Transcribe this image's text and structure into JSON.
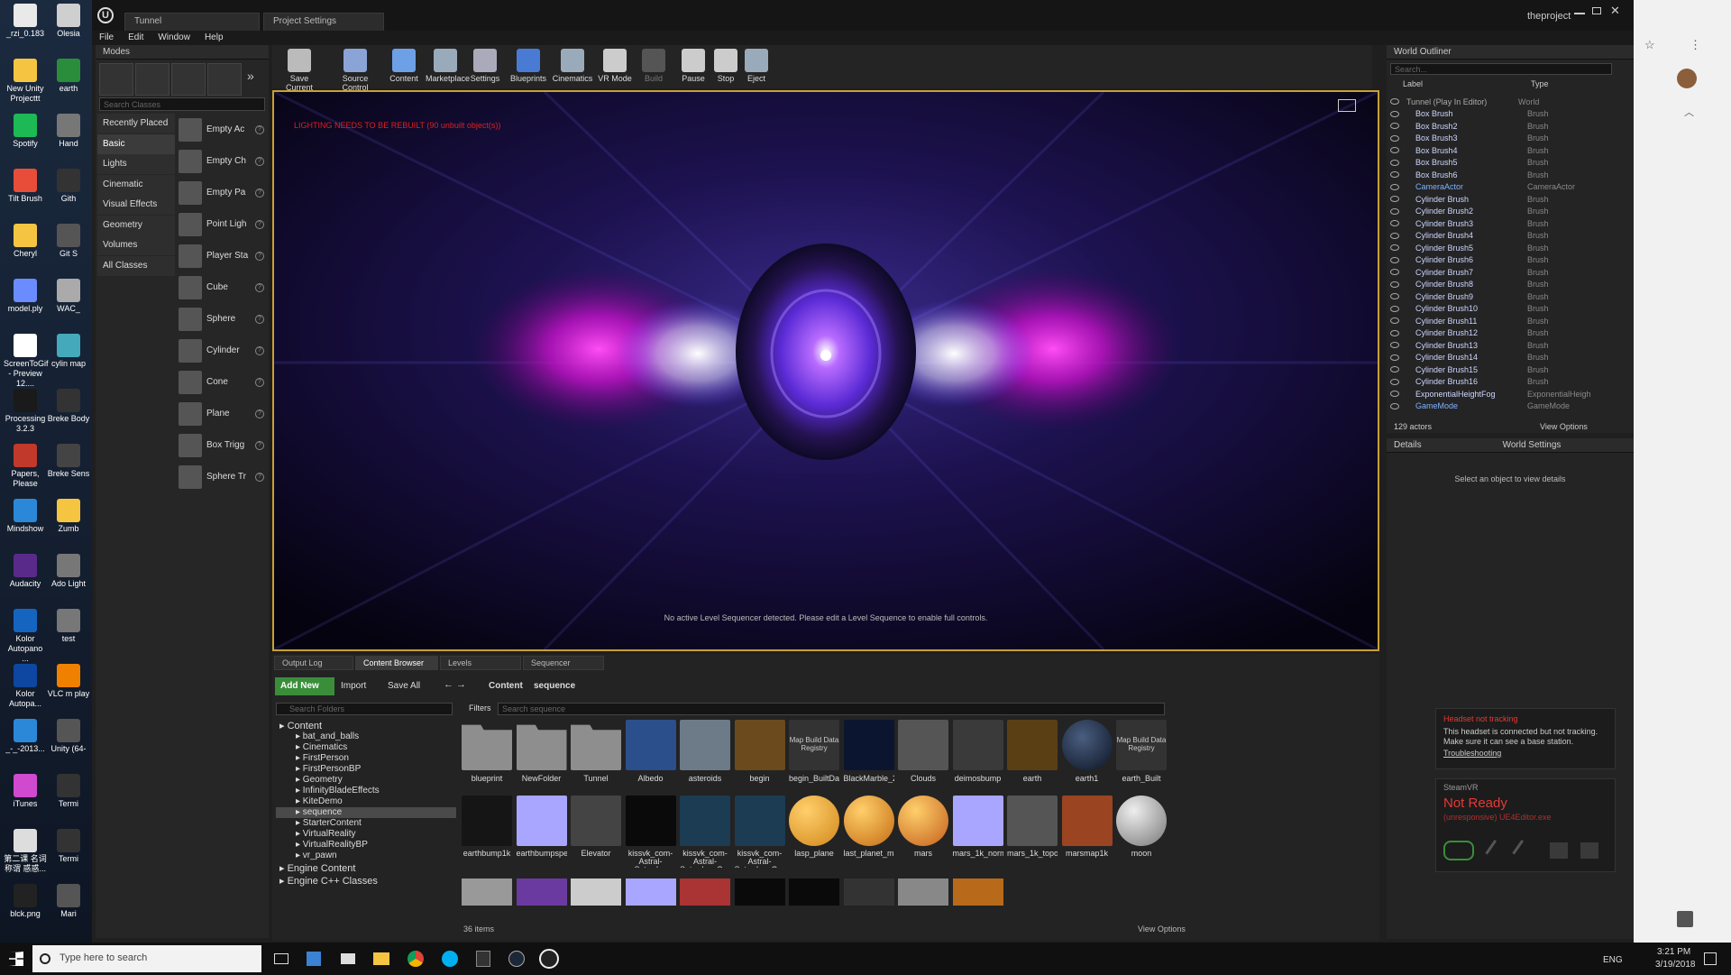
{
  "desktop_icons": [
    {
      "label": "_rzi_0.183"
    },
    {
      "label": "Olesia"
    },
    {
      "label": "New Unity Projecttt"
    },
    {
      "label": "earth"
    },
    {
      "label": "Spotify"
    },
    {
      "label": "Hand"
    },
    {
      "label": "Tilt Brush"
    },
    {
      "label": "Gith"
    },
    {
      "label": "Cheryl"
    },
    {
      "label": "Git S"
    },
    {
      "label": "model.ply"
    },
    {
      "label": "WAC_"
    },
    {
      "label": "ScreenToGif - Preview 12...."
    },
    {
      "label": "cylin map"
    },
    {
      "label": "Processing 3.2.3"
    },
    {
      "label": "Breke Body"
    },
    {
      "label": "Papers, Please"
    },
    {
      "label": "Breke Sens"
    },
    {
      "label": "Mindshow"
    },
    {
      "label": "Zumb"
    },
    {
      "label": "Audacity"
    },
    {
      "label": "Ado Light"
    },
    {
      "label": "Kolor Autopano ..."
    },
    {
      "label": "test"
    },
    {
      "label": "Kolor Autopa..."
    },
    {
      "label": "VLC m play"
    },
    {
      "label": "_-_-2013..."
    },
    {
      "label": "Unity (64-"
    },
    {
      "label": "iTunes"
    },
    {
      "label": "Termi"
    },
    {
      "label": "第二课 名词 称谓 惑惑..."
    },
    {
      "label": "Termi"
    },
    {
      "label": "blck.png"
    },
    {
      "label": "Mari"
    }
  ],
  "editor": {
    "tabs": [
      "Tunnel",
      "Project Settings"
    ],
    "project_name": "theproject",
    "menu": [
      "File",
      "Edit",
      "Window",
      "Help"
    ]
  },
  "modes": {
    "header": "Modes",
    "search_placeholder": "Search Classes",
    "categories": [
      "Recently Placed",
      "Basic",
      "Lights",
      "Cinematic",
      "Visual Effects",
      "Geometry",
      "Volumes",
      "All Classes"
    ],
    "items": [
      "Empty Ac",
      "Empty Ch",
      "Empty Pa",
      "Point Ligh",
      "Player Sta",
      "Cube",
      "Sphere",
      "Cylinder",
      "Cone",
      "Plane",
      "Box Trigg",
      "Sphere Tr"
    ]
  },
  "toolbar": [
    "Save Current",
    "Source Control",
    "Content",
    "Marketplace",
    "Settings",
    "Blueprints",
    "Cinematics",
    "VR Mode",
    "Build",
    "Pause",
    "Stop",
    "Eject"
  ],
  "viewport": {
    "warning": "LIGHTING NEEDS TO BE REBUILT (90 unbuilt object(s))",
    "status": "No active Level Sequencer detected. Please edit a Level Sequence to enable full controls."
  },
  "bottom": {
    "tabs": [
      "Output Log",
      "Content Browser",
      "Levels",
      "Sequencer"
    ],
    "add_new": "Add New",
    "import": "Import",
    "save_all": "Save All",
    "path": [
      "Content",
      "sequence"
    ],
    "search_folders": "Search Folders",
    "filters": "Filters",
    "search_assets": "Search sequence",
    "tree": [
      "Content",
      "bat_and_balls",
      "Cinematics",
      "FirstPerson",
      "FirstPersonBP",
      "Geometry",
      "InfinityBladeEffects",
      "KiteDemo",
      "sequence",
      "StarterContent",
      "VirtualReality",
      "VirtualRealityBP",
      "vr_pawn",
      "Engine Content",
      "Engine C++ Classes"
    ],
    "assets_row1": [
      "blueprint",
      "NewFolder",
      "Tunnel",
      "Albedo",
      "asteroids",
      "begin",
      "begin_BuiltData",
      "BlackMarble_2016_3km",
      "Clouds",
      "deimosbump",
      "earth",
      "earth1",
      "earth_Built"
    ],
    "assets_row2": [
      "earthbump1k",
      "earthbumpspec_8K_Earth_Normal_Map_1",
      "Elevator",
      "kissvk_com-Astral-Saturday",
      "kissvk_com-Astral-Saturday_Cue",
      "kissvk_com-Astral-Saturday_Cue1",
      "lasp_plane",
      "last_planet_mat",
      "mars",
      "mars_1k_normal_1",
      "mars_1k_topo_1_1",
      "marsmap1k",
      "moon"
    ],
    "map_build_label": "Map Build Data Registry",
    "item_count": "36 items",
    "view_options": "View Options"
  },
  "outliner": {
    "header": "World Outliner",
    "search_placeholder": "Search...",
    "col_label": "Label",
    "col_type": "Type",
    "rows": [
      {
        "label": "Tunnel (Play In Editor)",
        "type": "World"
      },
      {
        "label": "Box Brush",
        "type": "Brush"
      },
      {
        "label": "Box Brush2",
        "type": "Brush"
      },
      {
        "label": "Box Brush3",
        "type": "Brush"
      },
      {
        "label": "Box Brush4",
        "type": "Brush"
      },
      {
        "label": "Box Brush5",
        "type": "Brush"
      },
      {
        "label": "Box Brush6",
        "type": "Brush"
      },
      {
        "label": "CameraActor",
        "type": "CameraActor"
      },
      {
        "label": "Cylinder Brush",
        "type": "Brush"
      },
      {
        "label": "Cylinder Brush2",
        "type": "Brush"
      },
      {
        "label": "Cylinder Brush3",
        "type": "Brush"
      },
      {
        "label": "Cylinder Brush4",
        "type": "Brush"
      },
      {
        "label": "Cylinder Brush5",
        "type": "Brush"
      },
      {
        "label": "Cylinder Brush6",
        "type": "Brush"
      },
      {
        "label": "Cylinder Brush7",
        "type": "Brush"
      },
      {
        "label": "Cylinder Brush8",
        "type": "Brush"
      },
      {
        "label": "Cylinder Brush9",
        "type": "Brush"
      },
      {
        "label": "Cylinder Brush10",
        "type": "Brush"
      },
      {
        "label": "Cylinder Brush11",
        "type": "Brush"
      },
      {
        "label": "Cylinder Brush12",
        "type": "Brush"
      },
      {
        "label": "Cylinder Brush13",
        "type": "Brush"
      },
      {
        "label": "Cylinder Brush14",
        "type": "Brush"
      },
      {
        "label": "Cylinder Brush15",
        "type": "Brush"
      },
      {
        "label": "Cylinder Brush16",
        "type": "Brush"
      },
      {
        "label": "ExponentialHeightFog",
        "type": "ExponentialHeigh"
      },
      {
        "label": "GameMode",
        "type": "GameMode"
      }
    ],
    "actor_count": "129 actors",
    "view_options": "View Options"
  },
  "details": {
    "tab_details": "Details",
    "tab_world": "World Settings",
    "empty": "Select an object to view details"
  },
  "vr_notice": {
    "title": "Headset not tracking",
    "body": "This headset is connected but not tracking. Make sure it can see a base station.",
    "link": "Troubleshooting"
  },
  "steamvr": {
    "title": "SteamVR",
    "status": "Not Ready",
    "sub": "(unresponsive) UE4Editor.exe"
  },
  "taskbar": {
    "search_placeholder": "Type here to search",
    "lang": "ENG",
    "time": "3:21 PM",
    "date": "3/19/2018"
  },
  "colors": {
    "accent": "#c8a033",
    "warning": "#e02020",
    "vr_red": "#e53935",
    "green": "#3a8e3a"
  }
}
